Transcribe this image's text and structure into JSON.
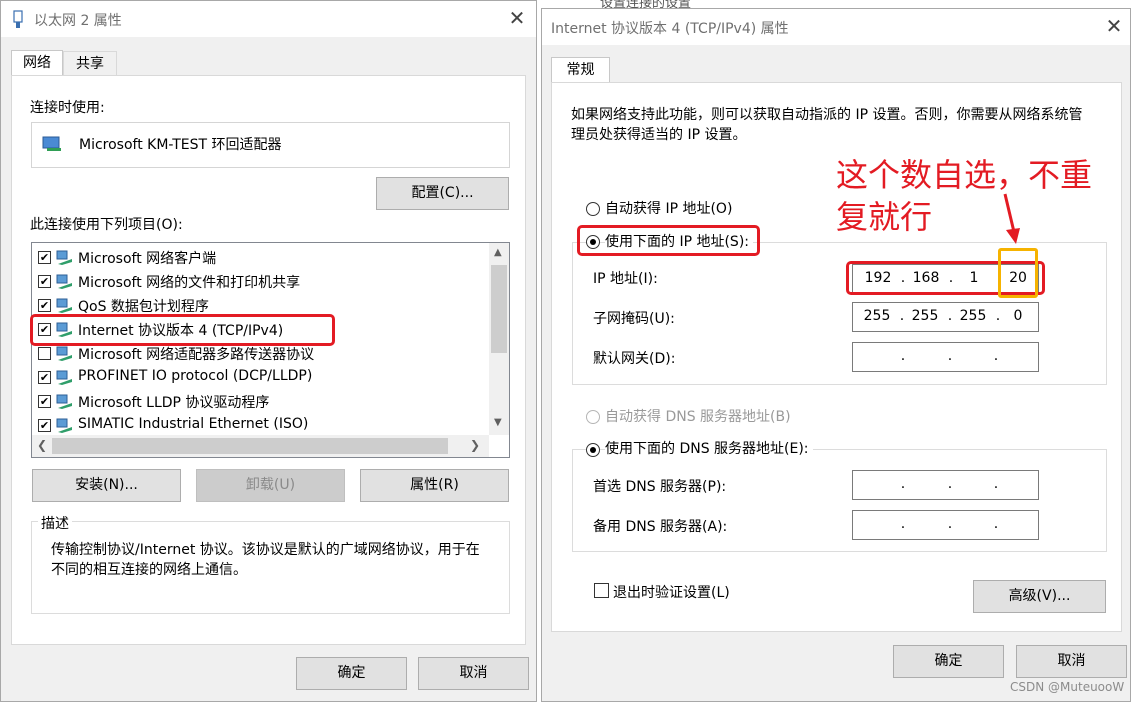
{
  "left_window": {
    "title": "以太网 2 属性",
    "tabs": [
      "网络",
      "共享"
    ],
    "connect_using_label": "连接时使用:",
    "adapter_name": "Microsoft KM-TEST 环回适配器",
    "configure_button": "配置(C)...",
    "items_label": "此连接使用下列项目(O):",
    "items": [
      {
        "checked": true,
        "label": "Microsoft 网络客户端"
      },
      {
        "checked": true,
        "label": "Microsoft 网络的文件和打印机共享"
      },
      {
        "checked": true,
        "label": "QoS 数据包计划程序"
      },
      {
        "checked": true,
        "label": "Internet 协议版本 4 (TCP/IPv4)"
      },
      {
        "checked": false,
        "label": "Microsoft 网络适配器多路传送器协议"
      },
      {
        "checked": true,
        "label": "PROFINET IO protocol (DCP/LLDP)"
      },
      {
        "checked": true,
        "label": "Microsoft LLDP 协议驱动程序"
      },
      {
        "checked": true,
        "label": "SIMATIC Industrial Ethernet (ISO)"
      }
    ],
    "install_button": "安装(N)...",
    "uninstall_button": "卸载(U)",
    "properties_button": "属性(R)",
    "description_label": "描述",
    "description_text": "传输控制协议/Internet 协议。该协议是默认的广域网络协议，用于在不同的相互连接的网络上通信。",
    "ok_button": "确定",
    "cancel_button": "取消"
  },
  "right_window": {
    "title": "Internet 协议版本 4 (TCP/IPv4) 属性",
    "tab": "常规",
    "intro_text": "如果网络支持此功能，则可以获取自动指派的 IP 设置。否则，你需要从网络系统管理员处获得适当的 IP 设置。",
    "auto_ip_label": "自动获得 IP 地址(O)",
    "manual_ip_label": "使用下面的 IP 地址(S):",
    "ip_address_label": "IP 地址(I):",
    "ip_address": [
      "192",
      "168",
      "1",
      "20"
    ],
    "subnet_label": "子网掩码(U):",
    "subnet_mask": [
      "255",
      "255",
      "255",
      "0"
    ],
    "gateway_label": "默认网关(D):",
    "gateway": [
      "",
      "",
      "",
      ""
    ],
    "auto_dns_label": "自动获得 DNS 服务器地址(B)",
    "manual_dns_label": "使用下面的 DNS 服务器地址(E):",
    "preferred_dns_label": "首选 DNS 服务器(P):",
    "alternate_dns_label": "备用 DNS 服务器(A):",
    "validate_label": "退出时验证设置(L)",
    "advanced_button": "高级(V)...",
    "ok_button": "确定",
    "cancel_button": "取消"
  },
  "annotation": {
    "text_line1": "这个数自选，不重",
    "text_line2": "复就行",
    "color": "#e31b23",
    "highlight_color": "#f6b300"
  },
  "watermark": "CSDN @MuteuooW",
  "background_fragment": "设置连接的设置"
}
